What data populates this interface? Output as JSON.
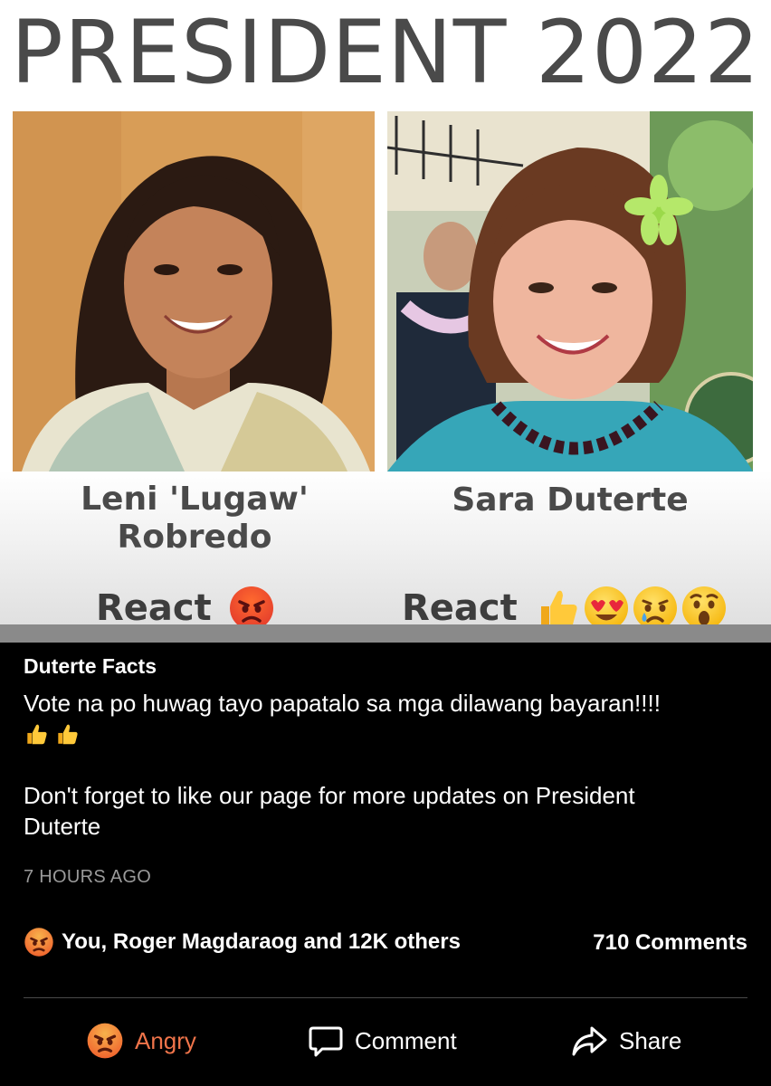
{
  "image": {
    "title": "PRESIDENT 2022",
    "candidates": [
      {
        "name_line1": "Leni 'Lugaw'",
        "name_line2": "Robredo",
        "react_label": "React",
        "reactions": [
          "angry"
        ]
      },
      {
        "name": "Sara Duterte",
        "react_label": "React",
        "reactions": [
          "thumbs-up",
          "heart-eyes",
          "crying",
          "surprised"
        ]
      }
    ]
  },
  "post": {
    "author": "Duterte Facts",
    "text_line1": "Vote na po huwag tayo papatalo sa mga dilawang bayaran!!!!",
    "text_emojis": [
      "thumbs-up",
      "thumbs-up"
    ],
    "text_line2": "Don't forget to like our page for more updates on President",
    "text_line3": "Duterte",
    "timestamp": "7 HOURS AGO",
    "reactions_summary": "You, Roger Magdaraog and 12K others",
    "comments_count": "710 Comments"
  },
  "actions": {
    "angry_label": "Angry",
    "comment_label": "Comment",
    "share_label": "Share"
  },
  "colors": {
    "background": "#000000",
    "angry_orange": "#f0744a",
    "timestamp_grey": "#9a9a9a",
    "title_grey": "#4a4a4a"
  }
}
